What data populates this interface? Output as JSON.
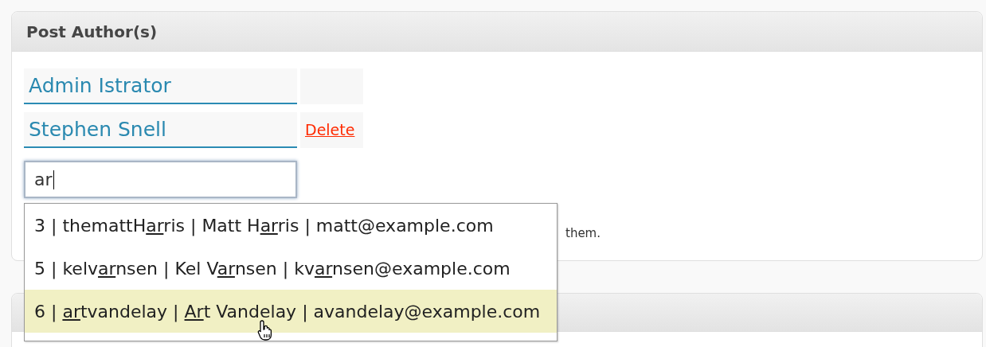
{
  "panel": {
    "title": "Post Author(s)"
  },
  "authors": [
    {
      "name": "Admin Istrator"
    },
    {
      "name": "Stephen Snell",
      "action": "Delete"
    }
  ],
  "search": {
    "value": "ar"
  },
  "suggestions": [
    {
      "selected": false,
      "parts": [
        {
          "text": "3 | themattH",
          "match": false
        },
        {
          "text": "ar",
          "match": true
        },
        {
          "text": "ris | Matt H",
          "match": false
        },
        {
          "text": "ar",
          "match": true
        },
        {
          "text": "ris | matt@example.com",
          "match": false
        }
      ]
    },
    {
      "selected": false,
      "parts": [
        {
          "text": "5 | kelv",
          "match": false
        },
        {
          "text": "ar",
          "match": true
        },
        {
          "text": "nsen | Kel V",
          "match": false
        },
        {
          "text": "ar",
          "match": true
        },
        {
          "text": "nsen | kv",
          "match": false
        },
        {
          "text": "ar",
          "match": true
        },
        {
          "text": "nsen@example.com",
          "match": false
        }
      ]
    },
    {
      "selected": true,
      "parts": [
        {
          "text": "6 | ",
          "match": false
        },
        {
          "text": "ar",
          "match": true
        },
        {
          "text": "tvandelay | ",
          "match": false
        },
        {
          "text": "Ar",
          "match": true
        },
        {
          "text": "t Vandelay | avandelay@example.com",
          "match": false
        }
      ]
    }
  ],
  "hint": "them."
}
